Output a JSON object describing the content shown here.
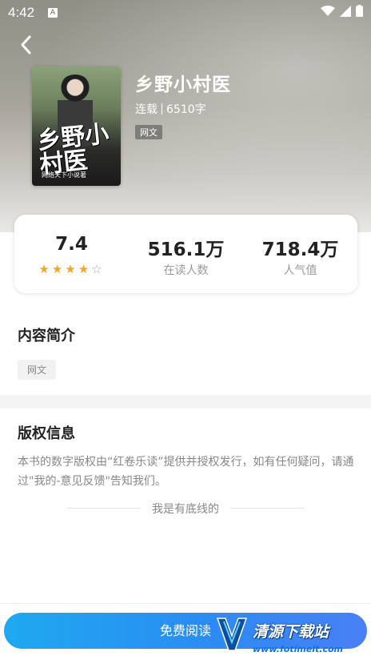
{
  "status_bar": {
    "time": "4:42",
    "notification_icon": "A"
  },
  "book": {
    "title": "乡野小村医",
    "status": "连载",
    "word_count": "6510字",
    "category_tag": "网文",
    "cover_title": "乡野小村医",
    "cover_subtitle": "网络天下小说著"
  },
  "stats": {
    "rating": "7.4",
    "rating_stars": 4,
    "readers": "516.1万",
    "readers_label": "在读人数",
    "popularity": "718.4万",
    "popularity_label": "人气值"
  },
  "intro": {
    "heading": "内容简介",
    "tag": "网文"
  },
  "copyright": {
    "heading": "版权信息",
    "text": "本书的数字版权由“红卷乐读”提供并授权发行，如有任何疑问，请通过\"我的-意见反馈\"告知我们。",
    "end_text": "我是有底线的"
  },
  "footer": {
    "read_button": "免费阅读"
  },
  "watermark": {
    "text": "清源下载站",
    "url": "www.fotimeit.com"
  },
  "colors": {
    "star": "#f5a623",
    "button_start": "#1fa9f0",
    "button_end": "#4a7ff5"
  }
}
